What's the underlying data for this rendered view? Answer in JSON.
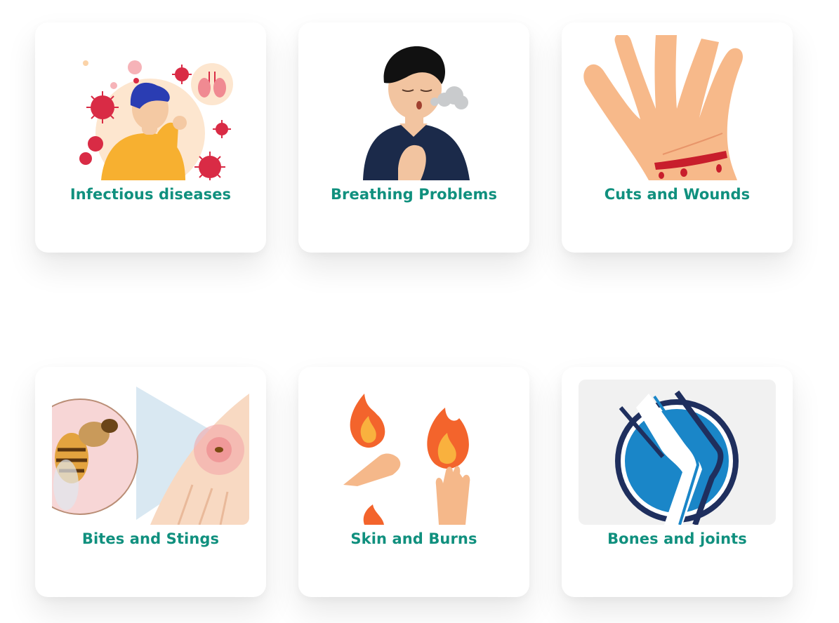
{
  "colors": {
    "title": "#10907e",
    "card_bg": "#ffffff",
    "page_bg": "#ffffff"
  },
  "cards": [
    {
      "title": "Infectious diseases",
      "icon": "coughing-person-virus-illustration"
    },
    {
      "title": "Breathing Problems",
      "icon": "person-breathing-illustration"
    },
    {
      "title": "Cuts and Wounds",
      "icon": "hand-cut-illustration"
    },
    {
      "title": "Bites and Stings",
      "icon": "bee-sting-illustration"
    },
    {
      "title": "Skin and Burns",
      "icon": "hands-fire-burn-illustration"
    },
    {
      "title": "Bones and joints",
      "icon": "knee-joint-illustration"
    }
  ]
}
